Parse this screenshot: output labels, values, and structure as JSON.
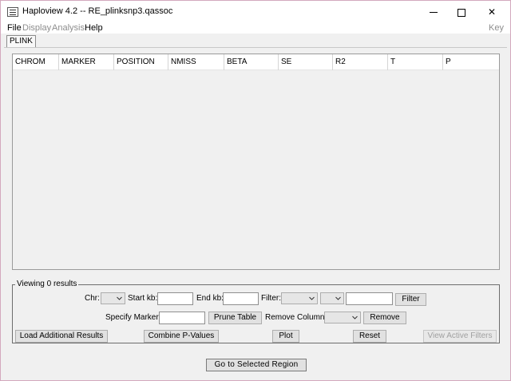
{
  "window": {
    "title": "Haploview 4.2 -- RE_plinksnp3.qassoc",
    "minimize_symbol": "—",
    "close_symbol": "✕"
  },
  "menu": {
    "file": "File",
    "display": "Display",
    "analysis": "Analysis",
    "help": "Help",
    "key": "Key"
  },
  "tabs": [
    {
      "label": "PLINK"
    }
  ],
  "table": {
    "columns": [
      "CHROM",
      "MARKER",
      "POSITION",
      "NMISS",
      "BETA",
      "SE",
      "R2",
      "T",
      "P"
    ],
    "rows": []
  },
  "filters": {
    "group_title": "Viewing 0 results",
    "chr_label": "Chr:",
    "start_kb_label": "Start kb:",
    "end_kb_label": "End kb:",
    "filter_label": "Filter:",
    "filter_button": "Filter",
    "specify_marker_label": "Specify Marker:",
    "prune_table_button": "Prune Table",
    "remove_column_label": "Remove Column:",
    "remove_button": "Remove",
    "load_results_button": "Load Additional Results",
    "combine_pvalues_button": "Combine P-Values",
    "plot_button": "Plot",
    "reset_button": "Reset",
    "view_active_filters_button": "View Active Filters",
    "start_kb_value": "",
    "end_kb_value": "",
    "filter_value": "",
    "specify_marker_value": ""
  },
  "footer": {
    "go_to_region_button": "Go to Selected Region"
  }
}
